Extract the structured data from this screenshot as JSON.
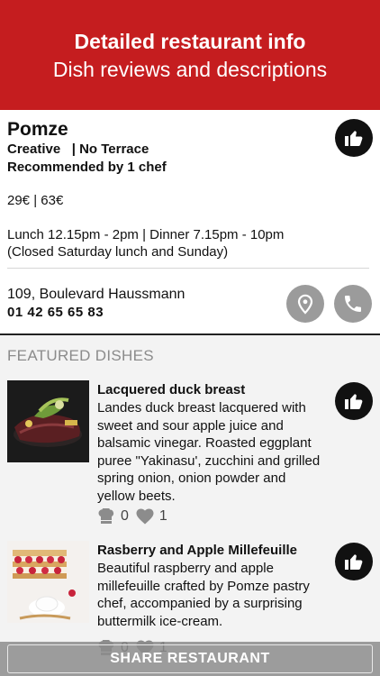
{
  "banner": {
    "title": "Detailed restaurant info",
    "subtitle": "Dish reviews and descriptions"
  },
  "restaurant": {
    "name": "Pomze",
    "attributes": "Creative   | No Terrace",
    "recommendation": "Recommended by 1 chef",
    "price": "29€ | 63€",
    "hours": "Lunch 12.15pm - 2pm | Dinner 7.15pm - 10pm",
    "closed": "(Closed Saturday lunch and Sunday)",
    "address": "109, Boulevard Haussmann",
    "phone": "01 42 65 65 83",
    "icons": {
      "like": "thumbs-up-icon",
      "location": "location-pin-icon",
      "call": "phone-icon"
    }
  },
  "featured": {
    "title": "FEATURED DISHES",
    "dishes": [
      {
        "name": "Lacquered duck breast",
        "description": "Landes duck breast lacquered with sweet and sour apple juice and balsamic vinegar. Roasted eggplant puree \"Yakinasu', zucchini and grilled spring onion, onion powder and yellow beets.",
        "chef_count": "0",
        "like_count": "1"
      },
      {
        "name": "Rasberry and Apple Millefeuille",
        "description": "Beautiful raspberry and apple millefeuille crafted by Pomze pastry chef, accompanied by a surprising buttermilk ice-cream.",
        "chef_count": "0",
        "like_count": "1"
      }
    ]
  },
  "share": {
    "label": "SHARE RESTAURANT"
  },
  "colors": {
    "banner": "#c51d1f",
    "icon_dark": "#111111",
    "icon_grey": "#9b9b9b",
    "section_bg": "#f3f3f3"
  }
}
